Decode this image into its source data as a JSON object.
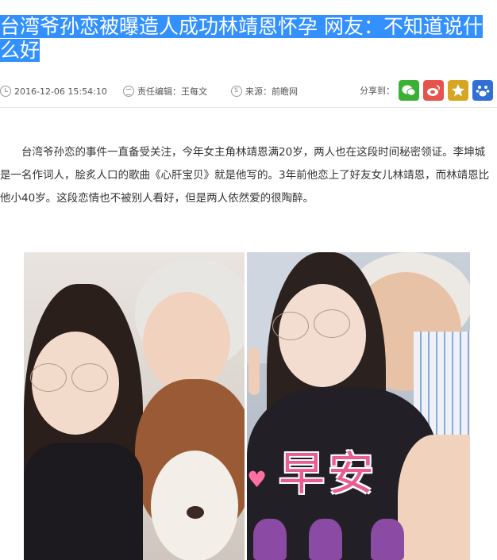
{
  "article": {
    "title": "台湾爷孙恋被曝造人成功林靖恩怀孕 网友：不知道说什么好",
    "date": "2016-12-06 15:54:10",
    "editor": "责任编辑：王每文",
    "source": "来源：前瞻网",
    "share_label": "分享到：",
    "paragraph": "台湾爷孙恋的事件一直备受关注，今年女主角林靖恩满20岁，两人也在这段时间秘密领证。李坤城是一名作词人，脍炙人口的歌曲《心肝宝贝》就是他写的。3年前他恋上了好友女儿林靖恩，而林靖恩比他小40岁。这段恋情也不被别人看好，但是两人依然爱的很陶醉。"
  },
  "share_buttons": [
    {
      "name": "wechat-share-button",
      "icon": "wechat-icon",
      "color": "#3cb034"
    },
    {
      "name": "weibo-share-button",
      "icon": "weibo-icon",
      "color": "#e6534d"
    },
    {
      "name": "qzone-share-button",
      "icon": "star-icon",
      "color": "#d6a522"
    },
    {
      "name": "baidu-share-button",
      "icon": "baidu-paw-icon",
      "color": "#2f6fd6"
    }
  ],
  "photo_caption": "早安",
  "colors": {
    "title_highlight": "#3390ff",
    "title_text": "#ffffff"
  }
}
